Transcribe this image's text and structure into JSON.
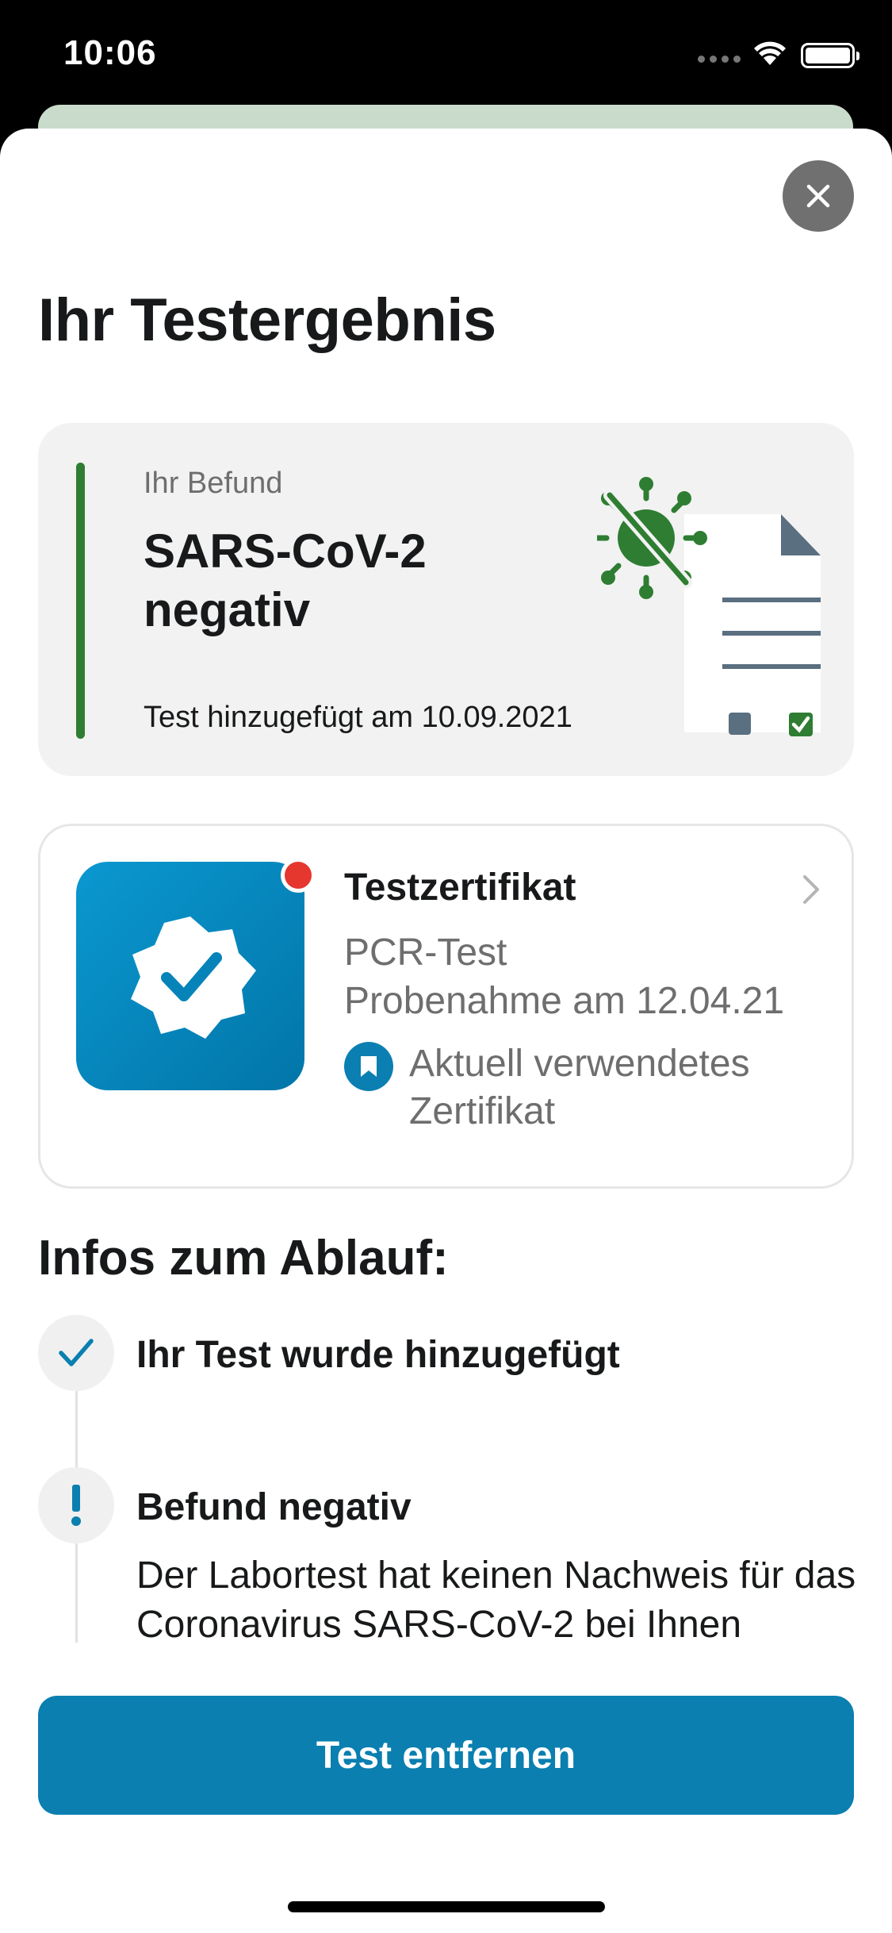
{
  "status_bar": {
    "time": "10:06"
  },
  "sheet": {
    "title": "Ihr Testergebnis",
    "close_icon": "close-icon"
  },
  "result_card": {
    "label": "Ihr Befund",
    "value": "SARS-CoV-2 negativ",
    "added": "Test hinzugefügt am 10.09.2021",
    "status_color": "#2e7d32",
    "illustration_icon": "virus-document-icon"
  },
  "certificate_card": {
    "title": "Testzertifikat",
    "type": "PCR-Test",
    "sample_date": "Probenahme am 12.04.21",
    "current": "Aktuell verwendetes Zertifikat",
    "icon": "certificate-check-icon",
    "badge_color": "#e5372e",
    "accent_color": "#0a7fb0"
  },
  "info": {
    "title": "Infos zum Ablauf:",
    "steps": [
      {
        "icon": "checkmark-icon",
        "title": "Ihr Test wurde hinzugefügt"
      },
      {
        "icon": "exclamation-icon",
        "title": "Befund negativ",
        "text": "Der Labortest hat keinen Nachweis für das Coronavirus SARS-CoV-2 bei Ihnen"
      }
    ]
  },
  "actions": {
    "remove_label": "Test entfernen"
  }
}
